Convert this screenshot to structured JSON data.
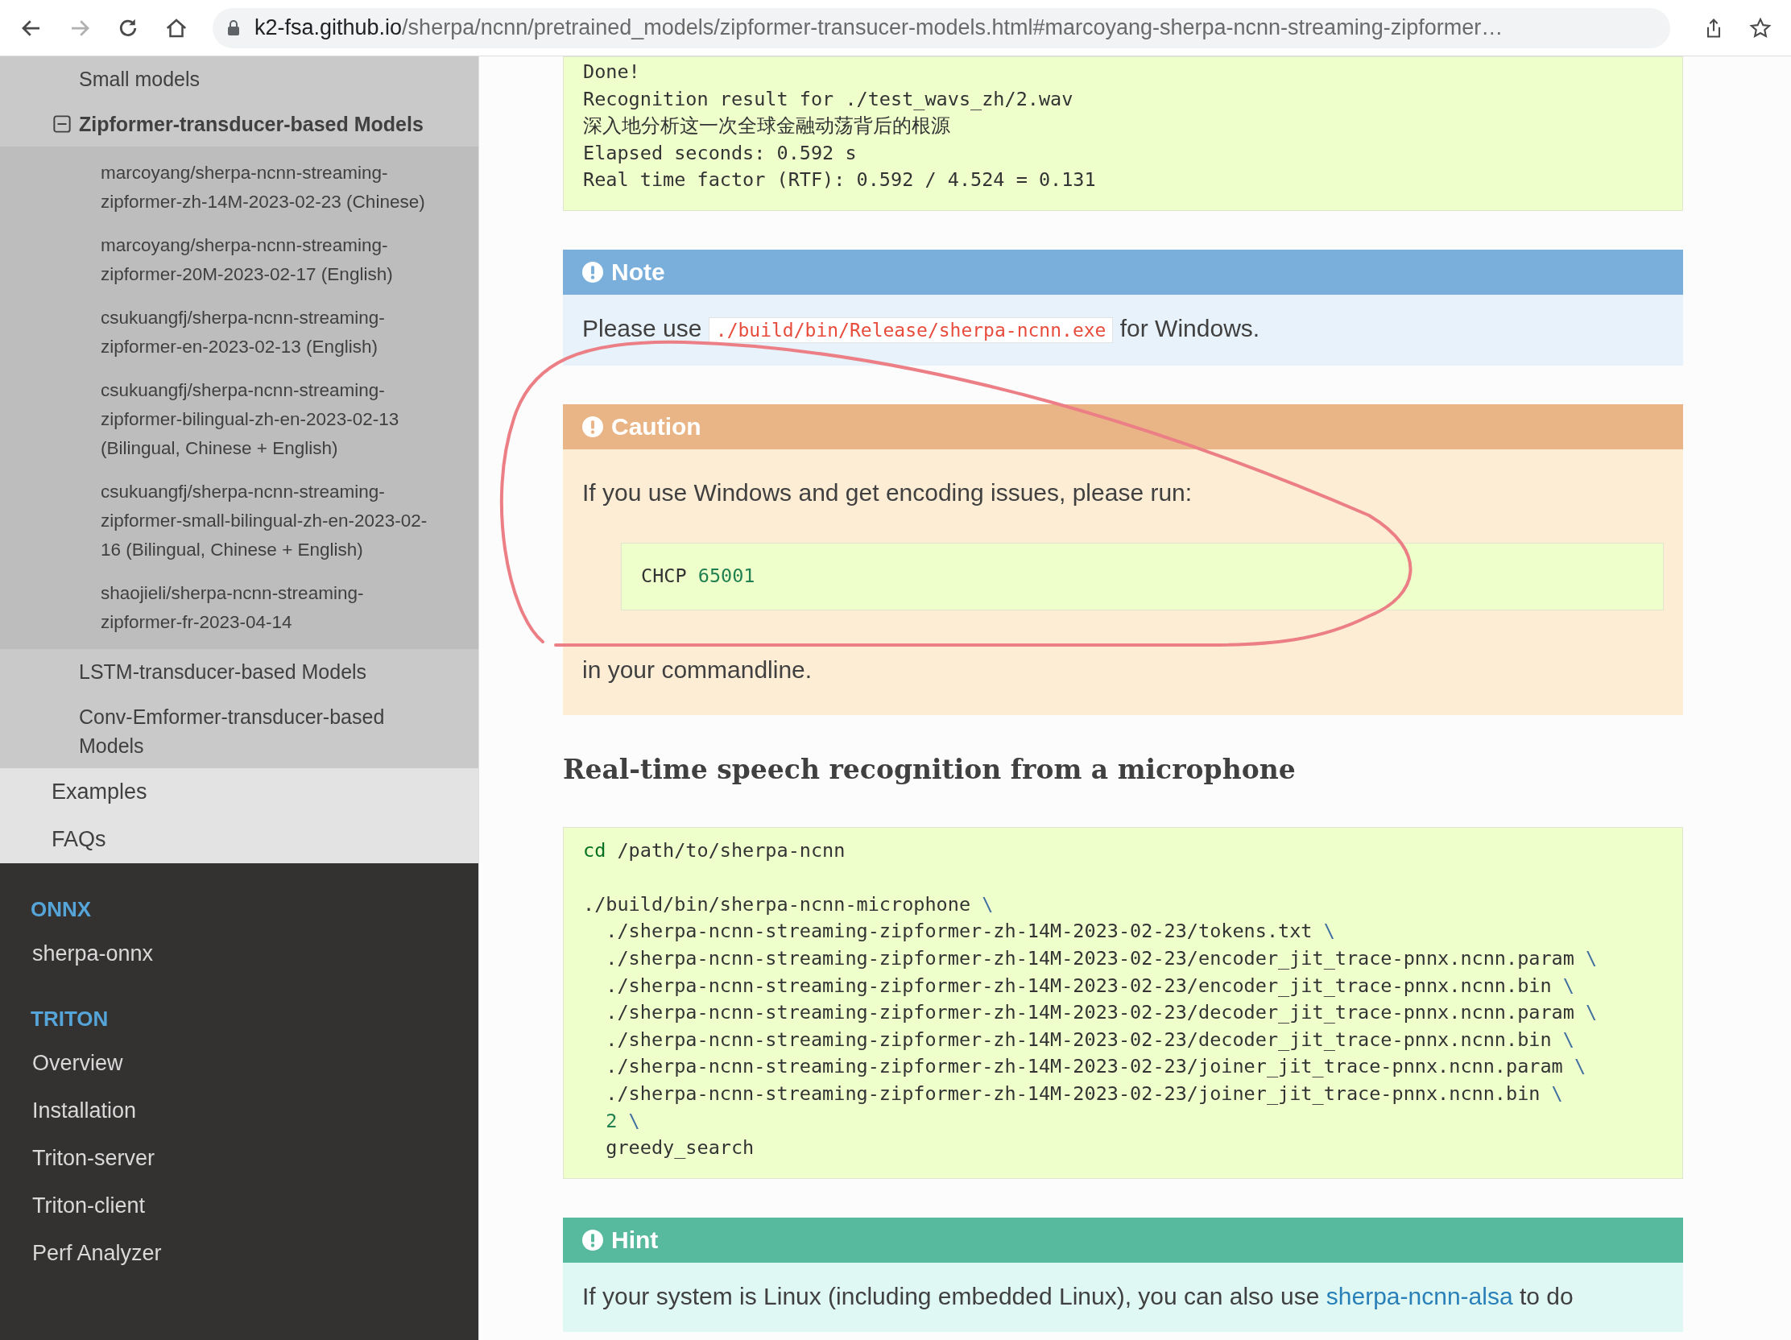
{
  "browser": {
    "buttons": [
      {
        "kind": "back",
        "disabled": false
      },
      {
        "kind": "forward",
        "disabled": true
      },
      {
        "kind": "reload",
        "disabled": false
      },
      {
        "kind": "home",
        "disabled": false
      }
    ],
    "url": {
      "host": "k2-fsa.github.io",
      "path": "/sherpa/ncnn/pretrained_models/zipformer-transucer-models.html#marcoyang-sherpa-ncnn-streaming-zipformer…"
    }
  },
  "sidebar": {
    "nav": [
      {
        "children": [
          {
            "label": "Small models",
            "selected": false
          },
          {
            "label": "Zipformer-transducer-based Models",
            "selected": true,
            "children": [
              {
                "label": "marcoyang/sherpa-ncnn-streaming-zipformer-zh-14M-2023-02-23 (Chinese)"
              },
              {
                "label": "marcoyang/sherpa-ncnn-streaming-zipformer-20M-2023-02-17 (English)"
              },
              {
                "label": "csukuangfj/sherpa-ncnn-streaming-zipformer-en-2023-02-13 (English)"
              },
              {
                "label": "csukuangfj/sherpa-ncnn-streaming-zipformer-bilingual-zh-en-2023-02-13 (Bilingual, Chinese + English)"
              },
              {
                "label": "csukuangfj/sherpa-ncnn-streaming-zipformer-small-bilingual-zh-en-2023-02-16 (Bilingual, Chinese + English)"
              },
              {
                "label": "shaojieli/sherpa-ncnn-streaming-zipformer-fr-2023-04-14"
              }
            ]
          },
          {
            "label": "LSTM-transducer-based Models",
            "selected": false
          },
          {
            "label": "Conv-Emformer-transducer-based Models",
            "selected": false
          }
        ]
      },
      {
        "label": "Examples"
      },
      {
        "label": "FAQs"
      }
    ],
    "captions": [
      {
        "title": "ONNX",
        "items": [
          "sherpa-onnx"
        ]
      },
      {
        "title": "TRITON",
        "items": [
          "Overview",
          "Installation",
          "Triton-server",
          "Triton-client",
          "Perf Analyzer"
        ]
      }
    ]
  },
  "content": {
    "output_block": [
      "Done!",
      "Recognition result for ./test_wavs_zh/2.wav",
      "深入地分析这一次全球金融动荡背后的根源",
      "Elapsed seconds: 0.592 s",
      "Real time factor (RTF): 0.592 / 4.524 = 0.131"
    ],
    "admonitions": [
      {
        "kind": "note",
        "title": "Note",
        "body": [
          {
            "kind": "para",
            "parts": [
              {
                "kind": "text",
                "t": "Please use "
              },
              {
                "kind": "code",
                "t": "./build/bin/Release/sherpa-ncnn.exe"
              },
              {
                "kind": "text",
                "t": " for Windows."
              }
            ]
          }
        ]
      },
      {
        "kind": "caution",
        "title": "Caution",
        "body": [
          {
            "kind": "para",
            "parts": [
              {
                "kind": "text",
                "t": "If you use Windows and get encoding issues, please run:"
              }
            ]
          },
          {
            "kind": "code",
            "lines": [
              [
                {
                  "kind": "plain",
                  "t": "CHCP "
                },
                {
                  "kind": "number",
                  "t": "65001"
                }
              ]
            ]
          },
          {
            "kind": "para",
            "parts": [
              {
                "kind": "text",
                "t": "in your commandline."
              }
            ]
          }
        ]
      }
    ],
    "heading": "Real-time speech recognition from a microphone",
    "command_block": [
      [
        [
          {
            "kind": "builtin",
            "t": "cd"
          },
          {
            "kind": "plain",
            "t": " /path/to/sherpa-ncnn"
          }
        ]
      ],
      [
        [
          {
            "kind": "plain",
            "t": "./build/bin/sherpa-ncnn-microphone "
          },
          {
            "kind": "escape",
            "t": "\\"
          }
        ],
        [
          {
            "kind": "plain",
            "t": "  ./sherpa-ncnn-streaming-zipformer-zh-14M-2023-02-23/tokens.txt "
          },
          {
            "kind": "escape",
            "t": "\\"
          }
        ],
        [
          {
            "kind": "plain",
            "t": "  ./sherpa-ncnn-streaming-zipformer-zh-14M-2023-02-23/encoder_jit_trace-pnnx.ncnn.param "
          },
          {
            "kind": "escape",
            "t": "\\"
          }
        ],
        [
          {
            "kind": "plain",
            "t": "  ./sherpa-ncnn-streaming-zipformer-zh-14M-2023-02-23/encoder_jit_trace-pnnx.ncnn.bin "
          },
          {
            "kind": "escape",
            "t": "\\"
          }
        ],
        [
          {
            "kind": "plain",
            "t": "  ./sherpa-ncnn-streaming-zipformer-zh-14M-2023-02-23/decoder_jit_trace-pnnx.ncnn.param "
          },
          {
            "kind": "escape",
            "t": "\\"
          }
        ],
        [
          {
            "kind": "plain",
            "t": "  ./sherpa-ncnn-streaming-zipformer-zh-14M-2023-02-23/decoder_jit_trace-pnnx.ncnn.bin "
          },
          {
            "kind": "escape",
            "t": "\\"
          }
        ],
        [
          {
            "kind": "plain",
            "t": "  ./sherpa-ncnn-streaming-zipformer-zh-14M-2023-02-23/joiner_jit_trace-pnnx.ncnn.param "
          },
          {
            "kind": "escape",
            "t": "\\"
          }
        ],
        [
          {
            "kind": "plain",
            "t": "  ./sherpa-ncnn-streaming-zipformer-zh-14M-2023-02-23/joiner_jit_trace-pnnx.ncnn.bin "
          },
          {
            "kind": "escape",
            "t": "\\"
          }
        ],
        [
          {
            "kind": "number",
            "t": "  2"
          },
          {
            "kind": "escape",
            "t": " \\"
          }
        ],
        [
          {
            "kind": "plain",
            "t": "  greedy_search"
          }
        ]
      ]
    ],
    "hint": {
      "kind": "hint",
      "title": "Hint",
      "parts": [
        {
          "kind": "text",
          "t": "If your system is Linux (including embedded Linux), you can also use "
        },
        {
          "kind": "link",
          "t": "sherpa-ncnn-alsa"
        },
        {
          "kind": "text",
          "t": " to do"
        }
      ]
    }
  }
}
